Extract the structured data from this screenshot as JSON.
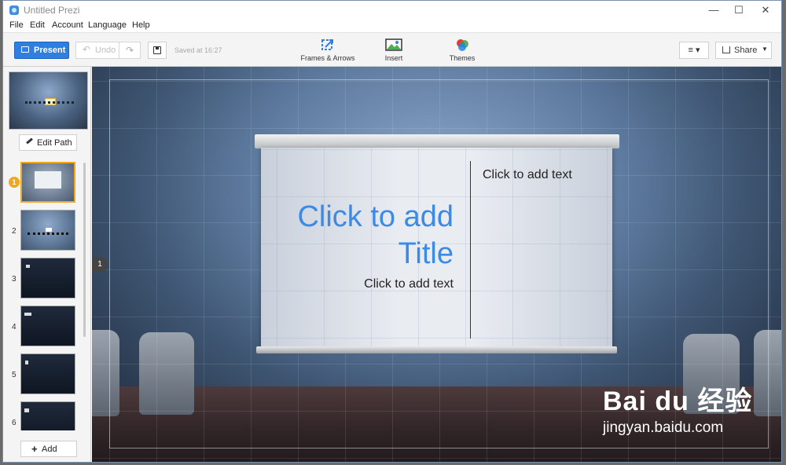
{
  "window": {
    "title": "Untitled Prezi",
    "minimize": "—",
    "maximize": "☐",
    "close": "✕"
  },
  "menu": [
    "File",
    "Edit",
    "Account",
    "Language",
    "Help"
  ],
  "toolbar": {
    "present": "Present",
    "undo": "Undo",
    "saved": "Saved at 16:27",
    "tools": [
      "Frames & Arrows",
      "Insert",
      "Themes"
    ],
    "share": "Share"
  },
  "sidebar": {
    "edit_path": "Edit Path",
    "slides": [
      "1",
      "2",
      "3",
      "4",
      "5",
      "6"
    ],
    "add": "Add"
  },
  "canvas": {
    "title_line1": "Click to add",
    "title_line2": "Title",
    "text_left": "Click to add text",
    "text_right": "Click to add text",
    "step_marker": "1"
  },
  "watermark": {
    "logo": "Bai du 经验",
    "url": "jingyan.baidu.com"
  },
  "colors": {
    "accent": "#2f7fe0",
    "selected": "#f0a71e",
    "title_placeholder": "#3a8ae6"
  }
}
